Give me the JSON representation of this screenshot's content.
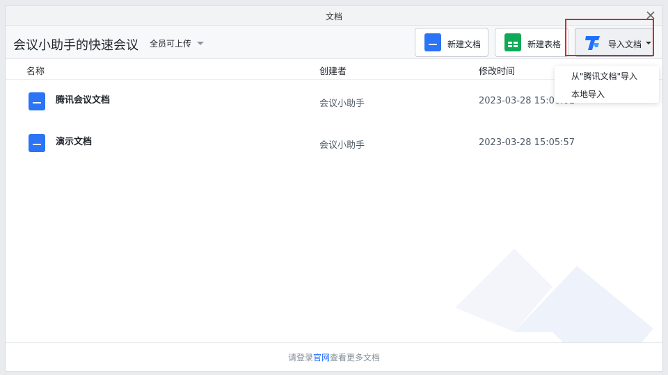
{
  "window": {
    "title": "文档",
    "close_icon": "close-icon"
  },
  "toolbar": {
    "meeting_title": "会议小助手的快速会议",
    "permission": "全员可上传",
    "new_doc": "新建文档",
    "new_sheet": "新建表格",
    "import_doc": "导入文档"
  },
  "table": {
    "columns": [
      "名称",
      "创建者",
      "修改时间"
    ],
    "rows": [
      {
        "name": "腾讯会议文档",
        "creator": "会议小助手",
        "modified": "2023-03-28 15:06:01"
      },
      {
        "name": "演示文档",
        "creator": "会议小助手",
        "modified": "2023-03-28 15:05:57"
      }
    ]
  },
  "import_menu": {
    "options": [
      "从\"腾讯文档\"导入",
      "本地导入"
    ]
  },
  "footer": {
    "prefix": "请登录",
    "link": "官网",
    "suffix": "查看更多文档"
  },
  "colors": {
    "accent": "#1e6fff",
    "doc_blue": "#2b74f5",
    "sheet_green": "#0fa958",
    "highlight_red": "#e02424"
  }
}
